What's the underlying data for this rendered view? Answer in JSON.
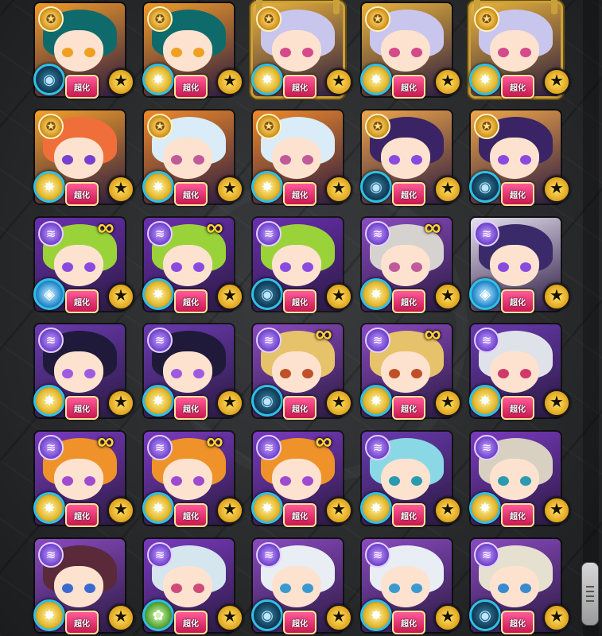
{
  "labels": {
    "limit_badge": "超化",
    "star_glyph": "★"
  },
  "icons": {
    "top_medal": "medal-icon",
    "top_swirl": "swirl-icon",
    "link": "link-icon",
    "element_light": "light-element-icon",
    "element_dark": "dark-element-icon",
    "element_wood": "wood-element-icon",
    "element_water": "water-element-icon",
    "star": "star-icon"
  },
  "colors": {
    "gold_frame": "#c9a13a",
    "link_gold": "#ffd23a",
    "limit_pink": "#e8286b"
  },
  "rows": [
    [
      {
        "hair": "#0f6b6b",
        "eye": "#f0a020",
        "bg": "#f19a2a",
        "element": "dark",
        "top": "medal",
        "link": false,
        "frame": "plain"
      },
      {
        "hair": "#0f6b6b",
        "eye": "#f0a020",
        "bg": "#f19a2a",
        "element": "light",
        "top": "medal",
        "link": false,
        "frame": "plain"
      },
      {
        "hair": "#c9c6ee",
        "eye": "#d44a8a",
        "bg": "#e9b33a",
        "element": "light",
        "top": "medal",
        "link": false,
        "frame": "gold"
      },
      {
        "hair": "#c9c6ee",
        "eye": "#d44a8a",
        "bg": "#e9b33a",
        "element": "light",
        "top": "medal",
        "link": false,
        "frame": "plain"
      },
      {
        "hair": "#c9c6ee",
        "eye": "#d44a8a",
        "bg": "#e9b33a",
        "element": "light",
        "top": "medal",
        "link": false,
        "frame": "gold"
      }
    ],
    [
      {
        "hair": "#f06e3a",
        "eye": "#7a3fd0",
        "bg": "#f4a02a",
        "element": "light",
        "top": "medal",
        "link": false,
        "frame": "plain"
      },
      {
        "hair": "#d9ecf7",
        "eye": "#c05a9a",
        "bg": "#f08a2a",
        "element": "light",
        "top": "medal",
        "link": false,
        "frame": "plain"
      },
      {
        "hair": "#d9ecf7",
        "eye": "#c05a9a",
        "bg": "#f08a2a",
        "element": "light",
        "top": "medal",
        "link": false,
        "frame": "plain"
      },
      {
        "hair": "#3a2466",
        "eye": "#8a4ae0",
        "bg": "#f0a64a",
        "element": "dark",
        "top": "medal",
        "link": false,
        "frame": "plain"
      },
      {
        "hair": "#3a2466",
        "eye": "#8a4ae0",
        "bg": "#f0a64a",
        "element": "dark",
        "top": "medal",
        "link": false,
        "frame": "plain"
      }
    ],
    [
      {
        "hair": "#9ad23a",
        "eye": "#8a4ae0",
        "bg": "#6a2fb0",
        "element": "water",
        "top": "swirl",
        "link": true,
        "frame": "plain"
      },
      {
        "hair": "#9ad23a",
        "eye": "#8a4ae0",
        "bg": "#6a2fb0",
        "element": "light",
        "top": "swirl",
        "link": true,
        "frame": "plain"
      },
      {
        "hair": "#9ad23a",
        "eye": "#8a4ae0",
        "bg": "#6a2fb0",
        "element": "dark",
        "top": "swirl",
        "link": false,
        "frame": "plain"
      },
      {
        "hair": "#d6d2d0",
        "eye": "#c05a9a",
        "bg": "#8a4ac0",
        "element": "light",
        "top": "swirl",
        "link": true,
        "frame": "plain"
      },
      {
        "hair": "#3a2a6a",
        "eye": "#8a4ae0",
        "bg": "#e6e0f0",
        "element": "water",
        "top": "swirl",
        "link": false,
        "frame": "plain"
      }
    ],
    [
      {
        "hair": "#1f1a3a",
        "eye": "#a05ae0",
        "bg": "#6a3ab0",
        "element": "light",
        "top": "swirl",
        "link": false,
        "frame": "plain"
      },
      {
        "hair": "#1f1a3a",
        "eye": "#a05ae0",
        "bg": "#6a3ab0",
        "element": "light",
        "top": "swirl",
        "link": false,
        "frame": "plain"
      },
      {
        "hair": "#e6c26a",
        "eye": "#c0502a",
        "bg": "#8a4ac0",
        "element": "dark",
        "top": "swirl",
        "link": true,
        "frame": "plain"
      },
      {
        "hair": "#e6c26a",
        "eye": "#c0502a",
        "bg": "#8a4ac0",
        "element": "light",
        "top": "swirl",
        "link": true,
        "frame": "plain"
      },
      {
        "hair": "#e0e2ea",
        "eye": "#d03a6a",
        "bg": "#6a3ab0",
        "element": "light",
        "top": "swirl",
        "link": false,
        "frame": "plain"
      }
    ],
    [
      {
        "hair": "#f0922a",
        "eye": "#a04ad0",
        "bg": "#7a3ac0",
        "element": "light",
        "top": "swirl",
        "link": true,
        "frame": "plain"
      },
      {
        "hair": "#f0922a",
        "eye": "#a04ad0",
        "bg": "#7a3ac0",
        "element": "light",
        "top": "swirl",
        "link": true,
        "frame": "plain"
      },
      {
        "hair": "#f0922a",
        "eye": "#a04ad0",
        "bg": "#7a3ac0",
        "element": "light",
        "top": "swirl",
        "link": true,
        "frame": "plain"
      },
      {
        "hair": "#8ad8e6",
        "eye": "#2a9ab0",
        "bg": "#6a3ab0",
        "element": "light",
        "top": "swirl",
        "link": false,
        "frame": "plain"
      },
      {
        "hair": "#d8d0c0",
        "eye": "#2a9ab0",
        "bg": "#7a3ac0",
        "element": "light",
        "top": "swirl",
        "link": false,
        "frame": "plain"
      }
    ],
    [
      {
        "hair": "#5a2a3a",
        "eye": "#3a6ad0",
        "bg": "#8a4ac0",
        "element": "light",
        "top": "swirl",
        "link": false,
        "frame": "plain"
      },
      {
        "hair": "#d6e6ee",
        "eye": "#d04a7a",
        "bg": "#7a3ac0",
        "element": "wood",
        "top": "swirl",
        "link": false,
        "frame": "plain"
      },
      {
        "hair": "#e8eef4",
        "eye": "#3a9ad0",
        "bg": "#8a4ac0",
        "element": "dark",
        "top": "swirl",
        "link": false,
        "frame": "plain"
      },
      {
        "hair": "#e8eef4",
        "eye": "#3a9ad0",
        "bg": "#8a4ac0",
        "element": "light",
        "top": "swirl",
        "link": false,
        "frame": "plain"
      },
      {
        "hair": "#e6e0d0",
        "eye": "#3a8ad0",
        "bg": "#8a4ac0",
        "element": "dark",
        "top": "swirl",
        "link": false,
        "frame": "plain"
      }
    ]
  ]
}
